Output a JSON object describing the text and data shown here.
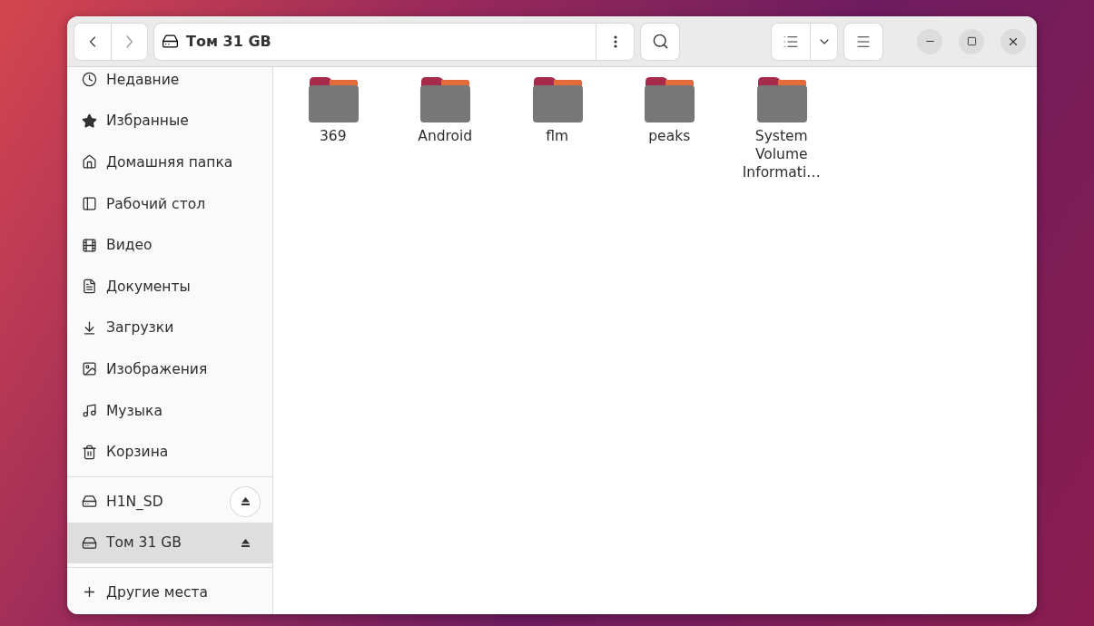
{
  "toolbar": {
    "location": "Том 31 GB"
  },
  "sidebar": {
    "places": [
      {
        "label": "Недавние",
        "kind": "recent",
        "selected": false
      },
      {
        "label": "Избранные",
        "kind": "starred",
        "selected": false
      },
      {
        "label": "Домашняя папка",
        "kind": "home",
        "selected": false
      },
      {
        "label": "Рабочий стол",
        "kind": "desktop",
        "selected": false
      },
      {
        "label": "Видео",
        "kind": "video",
        "selected": false
      },
      {
        "label": "Документы",
        "kind": "documents",
        "selected": false
      },
      {
        "label": "Загрузки",
        "kind": "downloads",
        "selected": false
      },
      {
        "label": "Изображения",
        "kind": "pictures",
        "selected": false
      },
      {
        "label": "Музыка",
        "kind": "music",
        "selected": false
      },
      {
        "label": "Корзина",
        "kind": "trash",
        "selected": false
      }
    ],
    "devices": [
      {
        "label": "H1N_SD",
        "selected": false,
        "eject_hovered": true
      },
      {
        "label": "Том 31 GB",
        "selected": true,
        "eject_hovered": false
      }
    ],
    "other": {
      "label": "Другие места"
    }
  },
  "files": [
    {
      "name": "369"
    },
    {
      "name": "Android"
    },
    {
      "name": "flm"
    },
    {
      "name": "peaks"
    },
    {
      "name": "System Volume Informati…"
    }
  ]
}
